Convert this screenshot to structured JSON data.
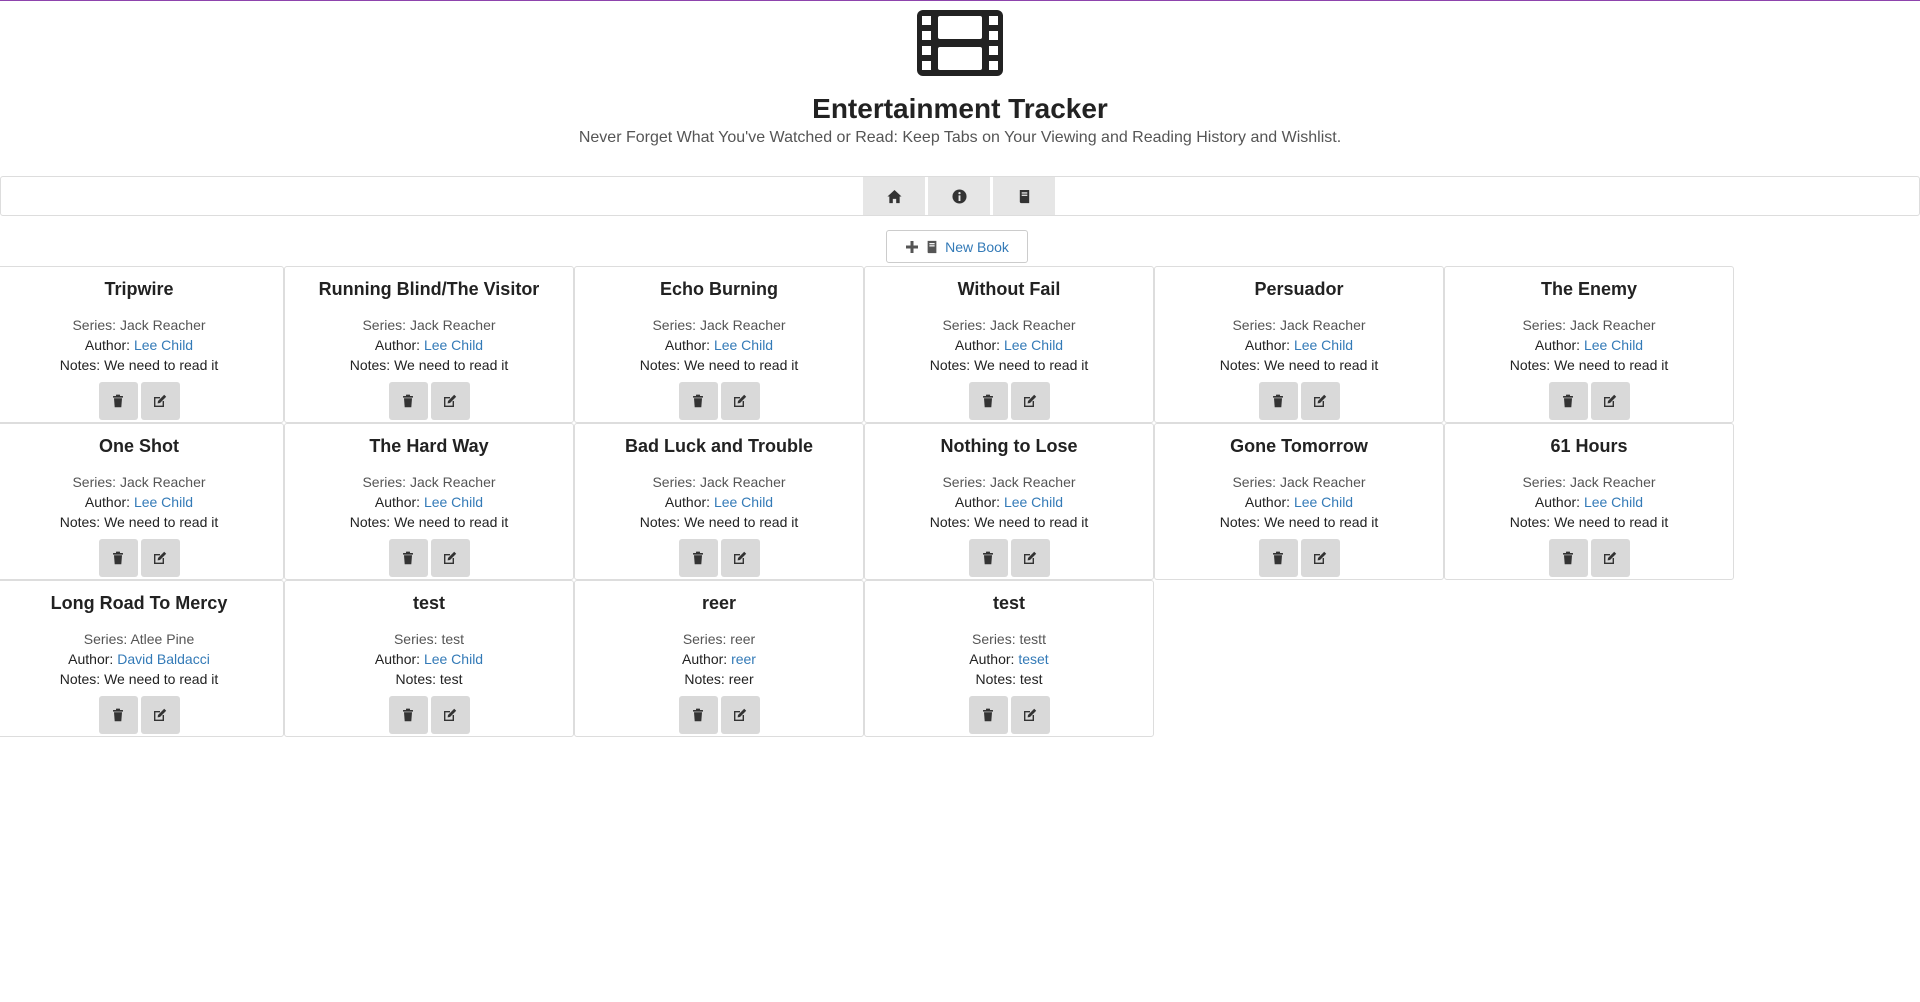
{
  "app": {
    "title": "Entertainment Tracker",
    "subtitle": "Never Forget What You've Watched or Read: Keep Tabs on Your Viewing and Reading History and Wishlist.",
    "logo_icon": "film-icon"
  },
  "nav": {
    "items": [
      {
        "icon": "home-icon"
      },
      {
        "icon": "info-icon"
      },
      {
        "icon": "book-icon"
      }
    ]
  },
  "actions": {
    "new_book_label": "New Book"
  },
  "labels": {
    "series": "Series:",
    "author": "Author:",
    "notes": "Notes:"
  },
  "books": [
    {
      "title": "Tripwire",
      "series": "Jack Reacher",
      "author": "Lee Child",
      "notes": "We need to read it"
    },
    {
      "title": "Running Blind/The Visitor",
      "series": "Jack Reacher",
      "author": "Lee Child",
      "notes": "We need to read it"
    },
    {
      "title": "Echo Burning",
      "series": "Jack Reacher",
      "author": "Lee Child",
      "notes": "We need to read it"
    },
    {
      "title": "Without Fail",
      "series": "Jack Reacher",
      "author": "Lee Child",
      "notes": "We need to read it"
    },
    {
      "title": "Persuador",
      "series": "Jack Reacher",
      "author": "Lee Child",
      "notes": "We need to read it"
    },
    {
      "title": "The Enemy",
      "series": "Jack Reacher",
      "author": "Lee Child",
      "notes": "We need to read it"
    },
    {
      "title": "One Shot",
      "series": "Jack Reacher",
      "author": "Lee Child",
      "notes": "We need to read it"
    },
    {
      "title": "The Hard Way",
      "series": "Jack Reacher",
      "author": "Lee Child",
      "notes": "We need to read it"
    },
    {
      "title": "Bad Luck and Trouble",
      "series": "Jack Reacher",
      "author": "Lee Child",
      "notes": "We need to read it"
    },
    {
      "title": "Nothing to Lose",
      "series": "Jack Reacher",
      "author": "Lee Child",
      "notes": "We need to read it"
    },
    {
      "title": "Gone Tomorrow",
      "series": "Jack Reacher",
      "author": "Lee Child",
      "notes": "We need to read it"
    },
    {
      "title": "61 Hours",
      "series": "Jack Reacher",
      "author": "Lee Child",
      "notes": "We need to read it"
    },
    {
      "title": "Long Road To Mercy",
      "series": "Atlee Pine",
      "author": "David Baldacci",
      "notes": "We need to read it"
    },
    {
      "title": "test",
      "series": "test",
      "author": "Lee Child",
      "notes": "test"
    },
    {
      "title": "reer",
      "series": "reer",
      "author": "reer",
      "notes": "reer"
    },
    {
      "title": "test",
      "series": "testt",
      "author": "teset",
      "notes": "test"
    }
  ]
}
